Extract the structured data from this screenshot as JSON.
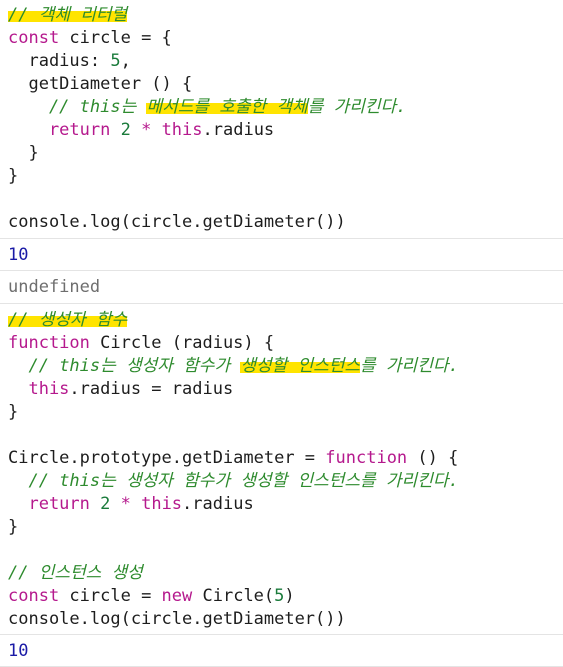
{
  "block1": {
    "comment_title": "// 객체 리터럴",
    "l1_kw": "const",
    "l1_rest": " circle = {",
    "l2": "  radius: ",
    "l2_num": "5",
    "l2_end": ",",
    "l3": "  getDiameter () {",
    "l4_prefix": "    // ",
    "l4_this": "this",
    "l4_a": "는 ",
    "l4_hl1": "메서드를 호출한 객체",
    "l4_b": "를 가리킨다.",
    "l5_kw": "    return",
    "l5_num": " 2",
    "l5_op": " * ",
    "l5_this": "this",
    "l5_end": ".radius",
    "l6": "  }",
    "l7": "}",
    "l9": "console.log(circle.getDiameter())"
  },
  "results": {
    "r1": "10",
    "r2": "undefined",
    "r3": "10"
  },
  "block2": {
    "comment_title": "// 생성자 함수",
    "l1_kw": "function",
    "l1_rest": " Circle (radius) {",
    "l2_prefix": "  // ",
    "l2_this": "this",
    "l2_a": "는 생성자 함수가 ",
    "l2_hl": "생성할 인스턴스",
    "l2_b": "를 가리킨다.",
    "l3_this": "  this",
    "l3_rest": ".radius = radius",
    "l4": "}",
    "l6_a": "Circle.prototype.getDiameter = ",
    "l6_kw": "function",
    "l6_b": " () {",
    "l7_prefix": "  // ",
    "l7_this": "this",
    "l7_rest": "는 생성자 함수가 생성할 인스턴스를 가리킨다.",
    "l8_kw": "  return",
    "l8_num": " 2",
    "l8_op": " * ",
    "l8_this": "this",
    "l8_end": ".radius",
    "l9": "}",
    "l11": "// 인스턴스 생성",
    "l12_kw": "const",
    "l12_a": " circle = ",
    "l12_kw2": "new",
    "l12_b": " Circle(",
    "l12_num": "5",
    "l12_c": ")",
    "l13": "console.log(circle.getDiameter())"
  },
  "colors": {
    "keyword": "#b5198d",
    "comment": "#2e8b2e",
    "this": "#0000cc",
    "highlight": "#ffe400",
    "result_number": "#1a1aa6",
    "undefined": "#6e6e6e"
  }
}
